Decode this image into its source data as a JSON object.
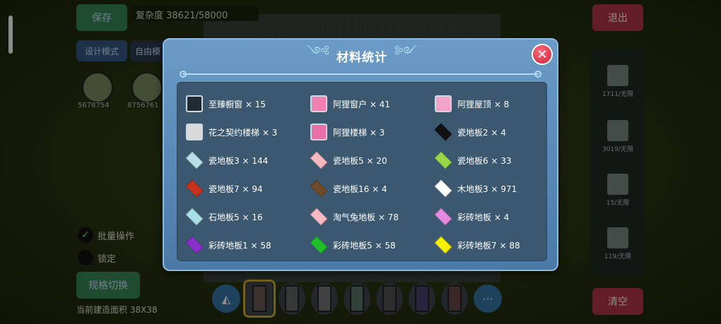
{
  "background": {
    "save_label": "保存",
    "complexity_text": "复杂度 38621/58000",
    "design_mode_label": "设计模式",
    "free_label": "自由模",
    "avatars": [
      "5678754",
      "8756761"
    ],
    "exit_label": "退出",
    "clear_label": "清空",
    "option_batch_label": "批量操作",
    "option_lock_label": "锁定",
    "spec_switch_label": "规格切换",
    "area_text": "当前建造面积 38X38",
    "right_panel": [
      "1711/无限",
      "3019/无限",
      "15/无限",
      "119/无限"
    ],
    "more_label": "···"
  },
  "modal": {
    "title": "材料统计",
    "close_icon": "close-icon",
    "items": [
      {
        "label": "至臻橱窗 × 15",
        "icon": "window-frame",
        "color": "#222a33"
      },
      {
        "label": "阿狸窗户 × 41",
        "icon": "fox-window",
        "color": "#f07fb2"
      },
      {
        "label": "阿狸屋顶 × 8",
        "icon": "fox-roof",
        "color": "#f4a3c8"
      },
      {
        "label": "花之契约楼梯 × 3",
        "icon": "flower-stair",
        "color": "#d9d9d9"
      },
      {
        "label": "阿狸楼梯 × 3",
        "icon": "fox-stair",
        "color": "#e870a6"
      },
      {
        "label": "瓷地板2 × 4",
        "icon": "tile",
        "color": "#111111"
      },
      {
        "label": "瓷地板3 × 144",
        "icon": "tile",
        "color": "#b9dde6"
      },
      {
        "label": "瓷地板5 × 20",
        "icon": "tile",
        "color": "#f5b8bf"
      },
      {
        "label": "瓷地板6 × 33",
        "icon": "tile",
        "color": "#9ad64a"
      },
      {
        "label": "瓷地板7 × 94",
        "icon": "tile",
        "color": "#c7321f"
      },
      {
        "label": "瓷地板16 × 4",
        "icon": "tile",
        "color": "#6e4a2a"
      },
      {
        "label": "木地板3 × 971",
        "icon": "tile",
        "color": "#ffffff"
      },
      {
        "label": "石地板5 × 16",
        "icon": "tile",
        "color": "#a8dfe4"
      },
      {
        "label": "淘气兔地板 × 78",
        "icon": "tile",
        "color": "#f5b8c4"
      },
      {
        "label": "彩砖地板 × 4",
        "icon": "tile",
        "color": "#e58ae0"
      },
      {
        "label": "彩砖地板1 × 58",
        "icon": "tile",
        "color": "#8a2fc9"
      },
      {
        "label": "彩砖地板5 × 58",
        "icon": "tile",
        "color": "#1fbf2a"
      },
      {
        "label": "彩砖地板7 × 88",
        "icon": "tile",
        "color": "#f4f000"
      }
    ]
  }
}
